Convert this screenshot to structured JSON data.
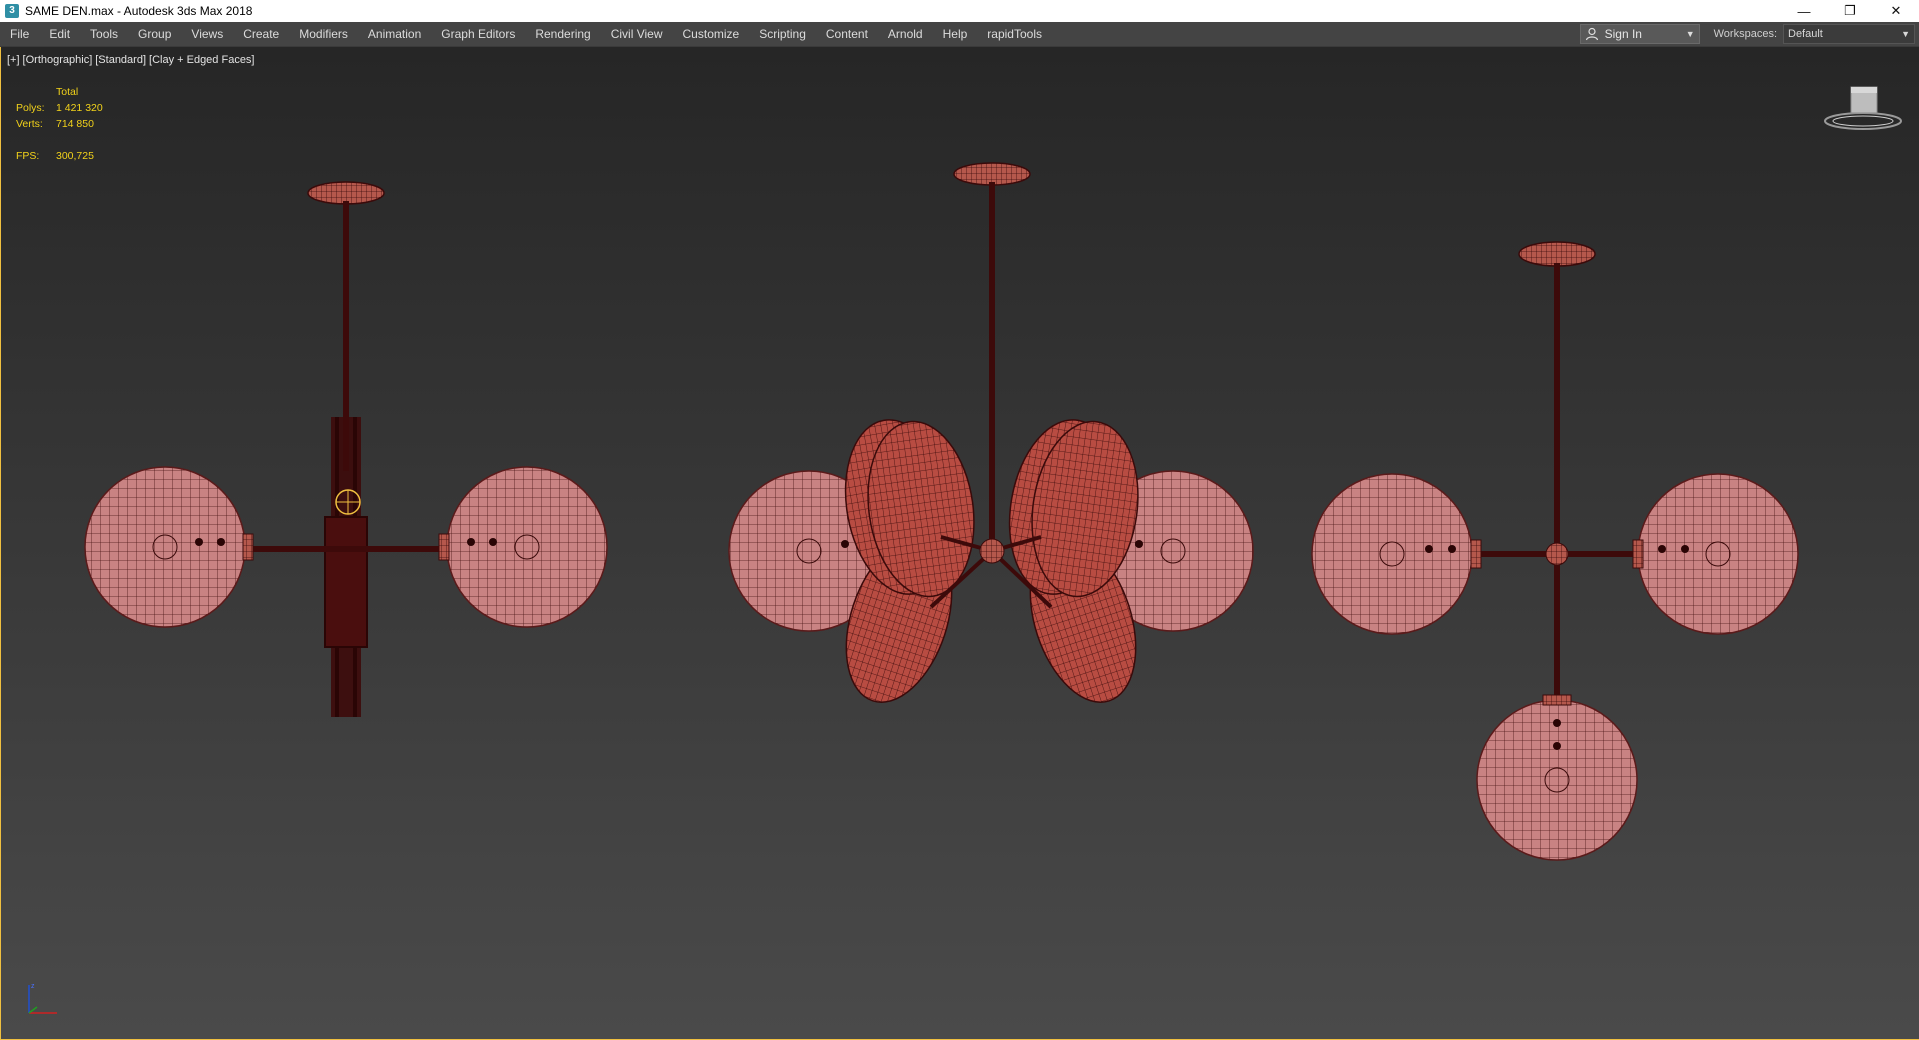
{
  "window": {
    "title": "SAME DEN.max - Autodesk 3ds Max 2018",
    "app_icon_text": "3"
  },
  "menu": {
    "items": [
      "File",
      "Edit",
      "Tools",
      "Group",
      "Views",
      "Create",
      "Modifiers",
      "Animation",
      "Graph Editors",
      "Rendering",
      "Civil View",
      "Customize",
      "Scripting",
      "Content",
      "Arnold",
      "Help",
      "rapidTools"
    ],
    "sign_in_label": "Sign In",
    "workspaces_label": "Workspaces:",
    "workspace_value": "Default"
  },
  "viewport": {
    "label_parts": [
      "[+]",
      "[Orthographic]",
      "[Standard]",
      "[Clay + Edged Faces]"
    ],
    "stats": {
      "header": "Total",
      "polys_label": "Polys:",
      "polys_value": "1 421 320",
      "verts_label": "Verts:",
      "verts_value": "714 850",
      "fps_label": "FPS:",
      "fps_value": "300,725"
    },
    "colors": {
      "mesh_fill": "#c98383",
      "mesh_fill_dark": "#b85045",
      "wire": "#3a0a0a",
      "rod": "#3d0a0a",
      "stats_text": "#f2d21a",
      "selection": "#f0c040"
    }
  },
  "icons": {
    "viewcube": "viewcube-icon",
    "axis": "axis-tripod-icon",
    "person": "person-icon"
  }
}
